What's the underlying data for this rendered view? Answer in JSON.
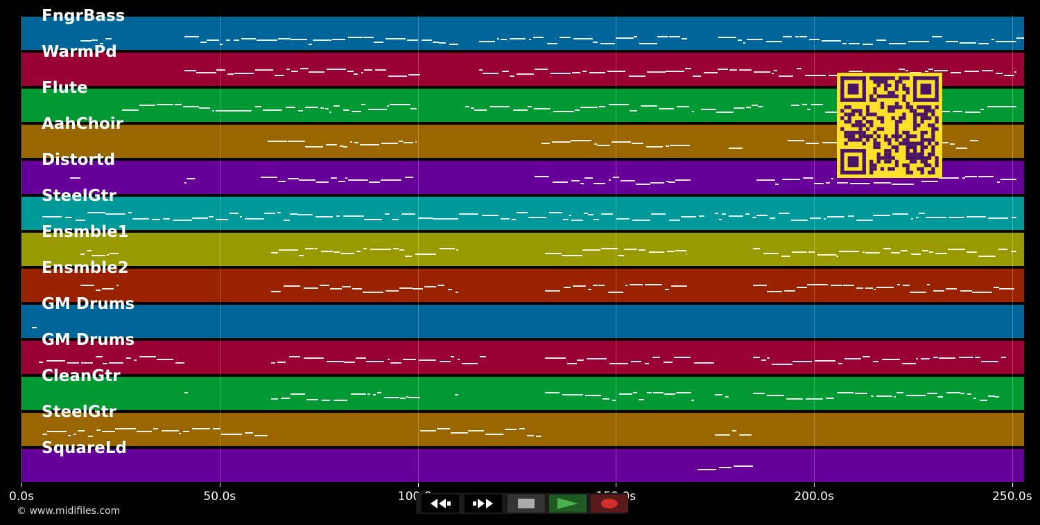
{
  "tracks": [
    {
      "name": "FngrBass",
      "color": "#006699"
    },
    {
      "name": "WarmPd",
      "color": "#990033"
    },
    {
      "name": "Flute",
      "color": "#009933"
    },
    {
      "name": "AahChoir",
      "color": "#996600"
    },
    {
      "name": "Distortd",
      "color": "#660099"
    },
    {
      "name": "SteelGtr",
      "color": "#009999"
    },
    {
      "name": "Ensmble1",
      "color": "#999900"
    },
    {
      "name": "Ensmble2",
      "color": "#992200"
    },
    {
      "name": "GM Drums",
      "color": "#006699"
    },
    {
      "name": "GM Drums",
      "color": "#990033"
    },
    {
      "name": "CleanGtr",
      "color": "#009933"
    },
    {
      "name": "SteelGtr",
      "color": "#996600"
    },
    {
      "name": "SquareLd",
      "color": "#660099"
    }
  ],
  "timeline": {
    "ticks": [
      "0.0s",
      "50.0s",
      "100.0s",
      "150.0s",
      "200.0s",
      "250.0s"
    ],
    "tick_values": [
      0,
      50,
      100,
      150,
      200,
      250
    ],
    "max_seconds": 253
  },
  "copyright": "© www.midifiles.com",
  "transport": {
    "rewind_icon": "rewind-icon",
    "forward_icon": "fast-forward-icon",
    "stop_icon": "stop-icon",
    "play_icon": "play-icon",
    "record_icon": "record-icon",
    "play_color": "#2e7d32",
    "record_color": "#d32f2f"
  },
  "qr_color": "#fce029",
  "qr_dark": "#4a1466"
}
